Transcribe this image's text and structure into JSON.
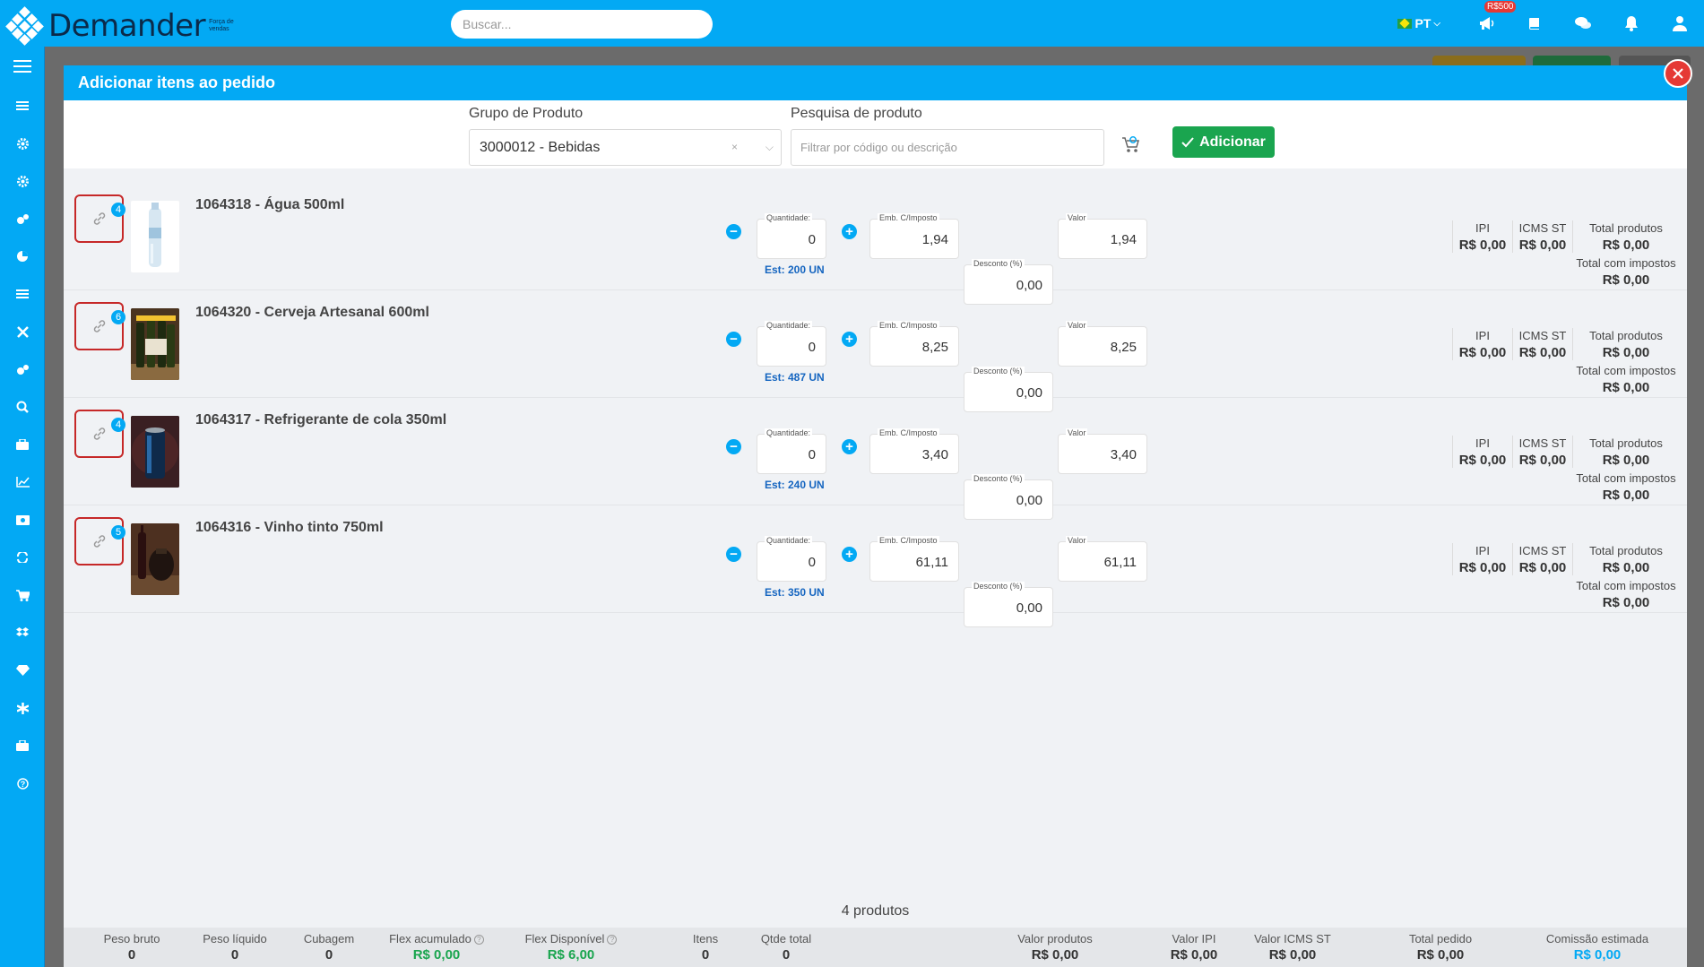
{
  "app": {
    "logo_text": "Demander",
    "logo_sub": "Força de vendas",
    "search_placeholder": "Buscar...",
    "lang": "PT",
    "promo_badge": "R$500"
  },
  "modal": {
    "title": "Adicionar itens ao pedido",
    "group_label": "Grupo de Produto",
    "group_value": "3000012 - Bebidas",
    "group_clear": "×",
    "search_label": "Pesquisa de produto",
    "search_placeholder": "Filtrar por código ou descrição",
    "add_button": "Adicionar"
  },
  "labels": {
    "quantity": "Quantidade:",
    "emb": "Emb. C/Imposto",
    "valor": "Valor",
    "desconto": "Desconto (%)",
    "ipi": "IPI",
    "icms": "ICMS ST",
    "total_prod": "Total produtos",
    "total_imp": "Total com impostos"
  },
  "products": [
    {
      "name": "1064318 - Água 500ml",
      "links": "4",
      "qty": "0",
      "emb": "1,94",
      "valor": "1,94",
      "desconto": "0,00",
      "est": "Est: 200 UN",
      "ipi": "R$ 0,00",
      "icms": "R$ 0,00",
      "total_prod": "R$ 0,00",
      "total_imp": "R$ 0,00"
    },
    {
      "name": "1064320 - Cerveja Artesanal 600ml",
      "links": "6",
      "qty": "0",
      "emb": "8,25",
      "valor": "8,25",
      "desconto": "0,00",
      "est": "Est: 487 UN",
      "ipi": "R$ 0,00",
      "icms": "R$ 0,00",
      "total_prod": "R$ 0,00",
      "total_imp": "R$ 0,00"
    },
    {
      "name": "1064317 - Refrigerante de cola 350ml",
      "links": "4",
      "qty": "0",
      "emb": "3,40",
      "valor": "3,40",
      "desconto": "0,00",
      "est": "Est: 240 UN",
      "ipi": "R$ 0,00",
      "icms": "R$ 0,00",
      "total_prod": "R$ 0,00",
      "total_imp": "R$ 0,00"
    },
    {
      "name": "1064316 - Vinho tinto 750ml",
      "links": "5",
      "qty": "0",
      "emb": "61,11",
      "valor": "61,11",
      "desconto": "0,00",
      "est": "Est: 350 UN",
      "ipi": "R$ 0,00",
      "icms": "R$ 0,00",
      "total_prod": "R$ 0,00",
      "total_imp": "R$ 0,00"
    }
  ],
  "footer": {
    "count": "4 produtos",
    "summary": [
      {
        "label": "Peso bruto",
        "value": "0"
      },
      {
        "label": "Peso líquido",
        "value": "0"
      },
      {
        "label": "Cubagem",
        "value": "0"
      },
      {
        "label": "Flex acumulado",
        "value": "R$ 0,00"
      },
      {
        "label": "Flex Disponível",
        "value": "R$ 6,00"
      },
      {
        "label": "Itens",
        "value": "0"
      },
      {
        "label": "Qtde total",
        "value": "0"
      },
      {
        "label": "Valor produtos",
        "value": "R$ 0,00"
      },
      {
        "label": "Valor IPI",
        "value": "R$ 0,00"
      },
      {
        "label": "Valor ICMS ST",
        "value": "R$ 0,00"
      },
      {
        "label": "Total pedido",
        "value": "R$ 0,00"
      },
      {
        "label": "Comissão estimada",
        "value": "R$ 0,00"
      }
    ]
  },
  "colors": {
    "primary": "#03a9f4",
    "success": "#1aa54f",
    "danger": "#e53935"
  }
}
